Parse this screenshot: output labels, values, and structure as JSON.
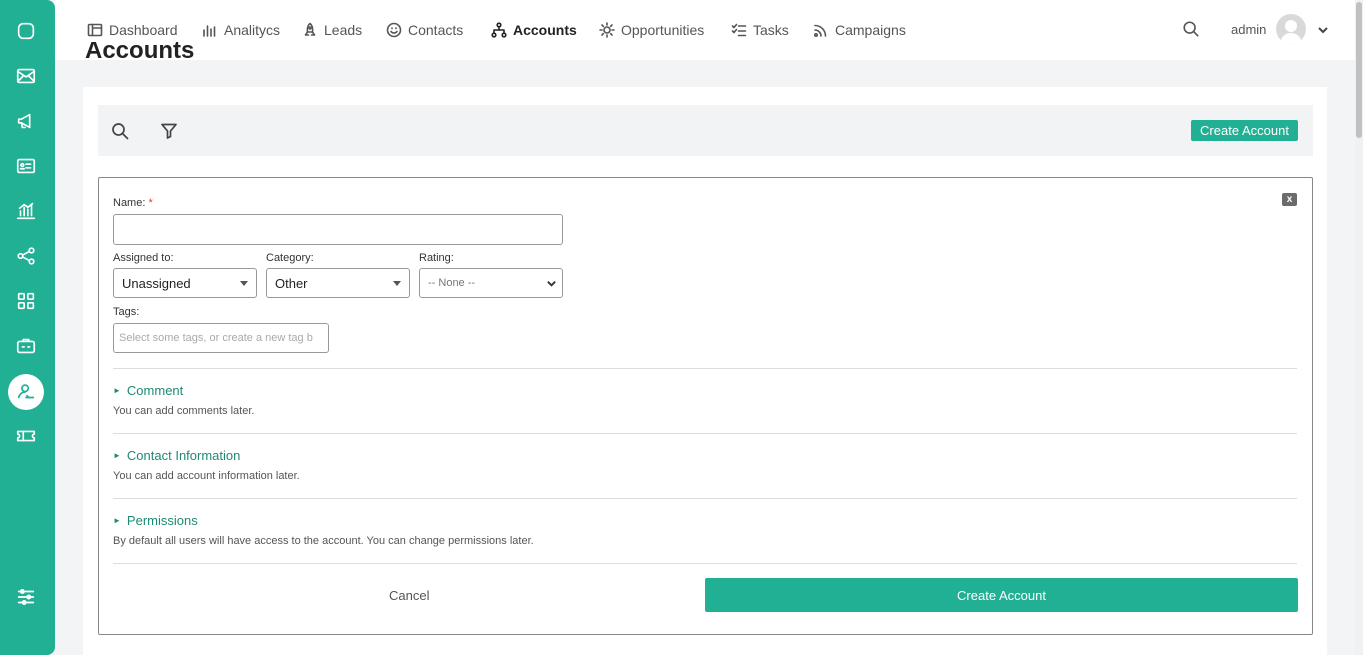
{
  "brand": {
    "accent": "#22b094",
    "link": "#1f8a73"
  },
  "sidebar": {
    "items": [
      {
        "icon": "chat-icon"
      },
      {
        "icon": "mail-icon"
      },
      {
        "icon": "megaphone-icon"
      },
      {
        "icon": "id-card-icon"
      },
      {
        "icon": "bar-chart-icon"
      },
      {
        "icon": "share-icon"
      },
      {
        "icon": "grid-icon"
      },
      {
        "icon": "briefcase-icon"
      },
      {
        "icon": "user-sign-icon",
        "active": true
      },
      {
        "icon": "ticket-icon"
      }
    ],
    "bottom_icon": "sliders-icon"
  },
  "nav": {
    "items": [
      {
        "label": "Dashboard",
        "icon": "layout-icon"
      },
      {
        "label": "Analitycs",
        "icon": "bars-icon"
      },
      {
        "label": "Leads",
        "icon": "rocket-icon"
      },
      {
        "label": "Contacts",
        "icon": "smile-icon"
      },
      {
        "label": "Accounts",
        "icon": "hierarchy-icon",
        "active": true
      },
      {
        "label": "Opportunities",
        "icon": "sun-icon"
      },
      {
        "label": "Tasks",
        "icon": "checklist-icon"
      },
      {
        "label": "Campaigns",
        "icon": "rss-icon"
      }
    ],
    "user": "admin"
  },
  "page": {
    "title": "Accounts"
  },
  "toolbar": {
    "create_label": "Create Account"
  },
  "form": {
    "close_label": "x",
    "name_label": "Name:",
    "required_mark": "*",
    "name_value": "",
    "assigned_label": "Assigned to:",
    "assigned_value": "Unassigned",
    "category_label": "Category:",
    "category_value": "Other",
    "rating_label": "Rating:",
    "rating_value": "-- None --",
    "tags_label": "Tags:",
    "tags_placeholder": "Select some tags, or create a new tag b",
    "sections": [
      {
        "title": "Comment",
        "note": "You can add comments later."
      },
      {
        "title": "Contact Information",
        "note": "You can add account information later."
      },
      {
        "title": "Permissions",
        "note": "By default all users will have access to the account. You can change permissions later."
      }
    ],
    "cancel_label": "Cancel",
    "submit_label": "Create Account"
  }
}
